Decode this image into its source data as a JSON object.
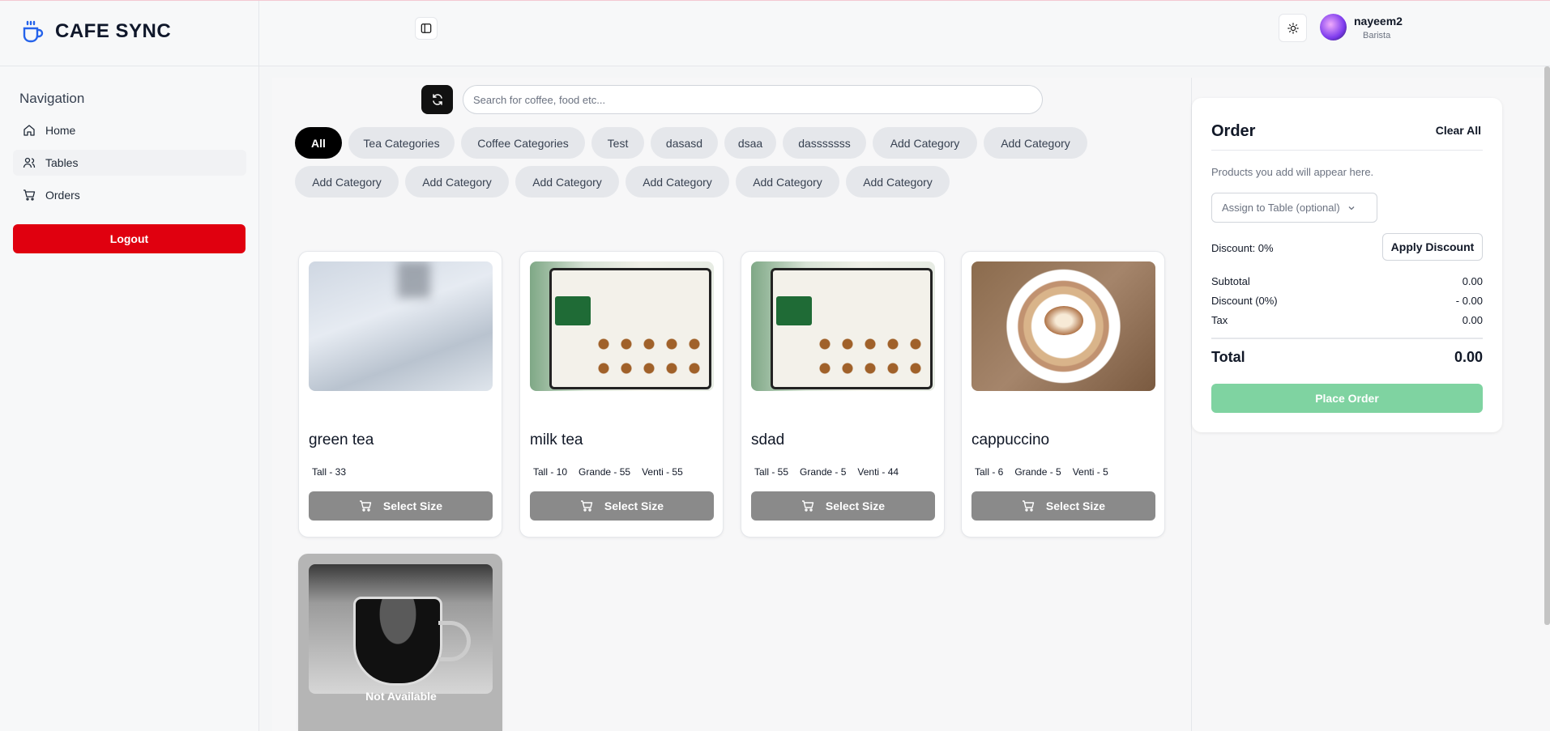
{
  "brand": {
    "name": "CAFE SYNC"
  },
  "user": {
    "name": "nayeem2",
    "role": "Barista"
  },
  "nav": {
    "title": "Navigation",
    "items": [
      {
        "label": "Home",
        "icon": "home-icon"
      },
      {
        "label": "Tables",
        "icon": "users-icon",
        "active": true
      },
      {
        "label": "Orders",
        "icon": "cart-icon"
      }
    ],
    "logout_label": "Logout"
  },
  "search": {
    "placeholder": "Search for coffee, food etc..."
  },
  "categories": [
    {
      "label": "All",
      "active": true
    },
    {
      "label": "Tea Categories"
    },
    {
      "label": "Coffee Categories"
    },
    {
      "label": "Test"
    },
    {
      "label": "dasasd"
    },
    {
      "label": "dsaa"
    },
    {
      "label": "dasssssss"
    },
    {
      "label": "Add Category"
    },
    {
      "label": "Add Category"
    },
    {
      "label": "Add Category"
    },
    {
      "label": "Add Category"
    },
    {
      "label": "Add Category"
    },
    {
      "label": "Add Category"
    },
    {
      "label": "Add Category"
    },
    {
      "label": "Add Category"
    }
  ],
  "products": [
    {
      "name": "green tea",
      "sizes": [
        "Tall - 33"
      ],
      "button": "Select Size",
      "available": true
    },
    {
      "name": "milk tea",
      "sizes": [
        "Tall - 10",
        "Grande - 55",
        "Venti - 55"
      ],
      "button": "Select Size",
      "available": true
    },
    {
      "name": "sdad",
      "sizes": [
        "Tall - 55",
        "Grande - 5",
        "Venti - 44"
      ],
      "button": "Select Size",
      "available": true
    },
    {
      "name": "cappuccino",
      "sizes": [
        "Tall - 6",
        "Grande - 5",
        "Venti - 5"
      ],
      "button": "Select Size",
      "available": true
    },
    {
      "name": "",
      "sizes": [],
      "button": "",
      "available": false,
      "status": "Not Available"
    }
  ],
  "order": {
    "title": "Order",
    "clear_label": "Clear All",
    "empty_text": "Products you add will appear here.",
    "assign_placeholder": "Assign to Table (optional)",
    "discount_label": "Discount: 0%",
    "apply_discount_label": "Apply Discount",
    "subtotal_label": "Subtotal",
    "subtotal_value": "0.00",
    "discount_row_label": "Discount (0%)",
    "discount_row_value": "- 0.00",
    "tax_label": "Tax",
    "tax_value": "0.00",
    "total_label": "Total",
    "total_value": "0.00",
    "place_order_label": "Place Order"
  },
  "colors": {
    "logout": "#e0000f",
    "place_order": "#7fd3a1",
    "brand_icon": "#2563eb"
  }
}
